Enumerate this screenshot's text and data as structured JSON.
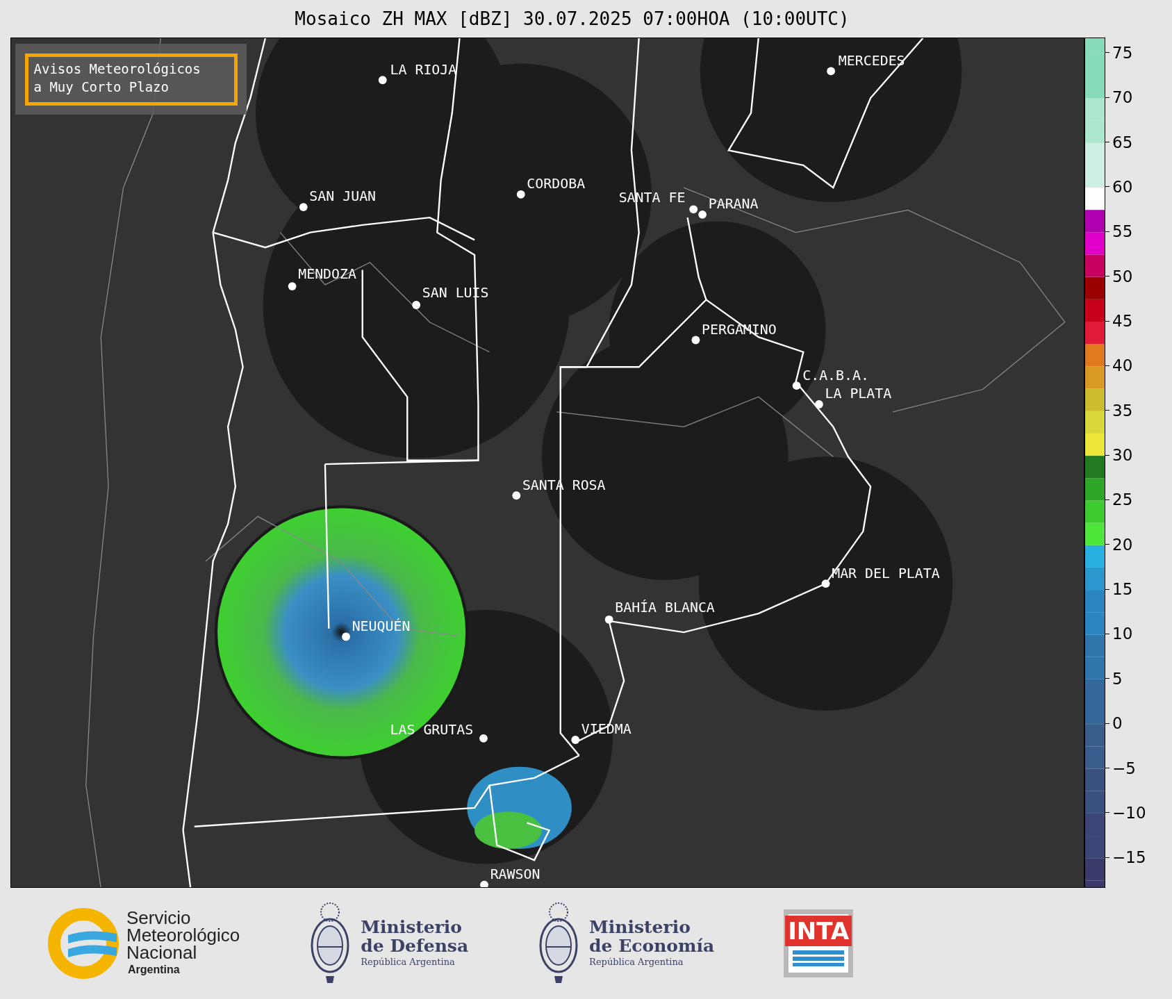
{
  "title": "Mosaico ZH MAX [dBZ] 30.07.2025 07:00HOA (10:00UTC)",
  "notice": {
    "lines": [
      "Avisos Meteorológicos",
      "a Muy Corto Plazo"
    ]
  },
  "cities": [
    {
      "name": "LA RIOJA"
    },
    {
      "name": "MERCEDES"
    },
    {
      "name": "SAN JUAN"
    },
    {
      "name": "CORDOBA"
    },
    {
      "name": "SANTA FE"
    },
    {
      "name": "PARANA"
    },
    {
      "name": "MENDOZA"
    },
    {
      "name": "SAN LUIS"
    },
    {
      "name": "PERGAMINO"
    },
    {
      "name": "C.A.B.A."
    },
    {
      "name": "LA PLATA"
    },
    {
      "name": "SANTA ROSA"
    },
    {
      "name": "MAR DEL PLATA"
    },
    {
      "name": "BAHÍA BLANCA"
    },
    {
      "name": "NEUQUÉN"
    },
    {
      "name": "LAS GRUTAS"
    },
    {
      "name": "VIEDMA"
    },
    {
      "name": "RAWSON"
    }
  ],
  "colorbar": {
    "ticks": [
      "75",
      "70",
      "65",
      "60",
      "55",
      "50",
      "45",
      "40",
      "35",
      "30",
      "25",
      "20",
      "15",
      "10",
      "5",
      "0",
      "−5",
      "−10",
      "−15"
    ]
  },
  "logos": [
    {
      "kind": "smn",
      "lines": [
        "Servicio",
        "Meteorológico",
        "Nacional"
      ],
      "subtitle": "Argentina"
    },
    {
      "kind": "ministry",
      "lines": [
        "Ministerio",
        "de Defensa"
      ],
      "subtitle": "República Argentina"
    },
    {
      "kind": "ministry",
      "lines": [
        "Ministerio",
        "de Economía"
      ],
      "subtitle": "República Argentina"
    },
    {
      "kind": "inta",
      "text": "INTA"
    }
  ]
}
